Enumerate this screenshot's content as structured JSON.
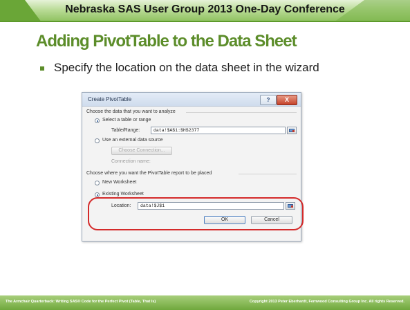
{
  "header": {
    "conference": "Nebraska SAS User Group 2013 One-Day Conference"
  },
  "slide": {
    "title": "Adding PivotTable to the Data Sheet",
    "bullet": "Specify the location on the data sheet in the wizard"
  },
  "dialog": {
    "title": "Create PivotTable",
    "help_label": "?",
    "close_label": "X",
    "section1_label": "Choose the data that you want to analyze",
    "option_select_range": "Select a table or range",
    "table_range_label": "Table/Range:",
    "table_range_value": "data!$A$1:$H$2377",
    "option_external": "Use an external data source",
    "choose_connection_label": "Choose Connection...",
    "connection_name_label": "Connection name:",
    "section2_label": "Choose where you want the PivotTable report to be placed",
    "option_new_worksheet": "New Worksheet",
    "option_existing_worksheet": "Existing Worksheet",
    "location_label": "Location:",
    "location_value": "data!$J$1",
    "ok_label": "OK",
    "cancel_label": "Cancel",
    "selected_data_option": "Select a table or range",
    "selected_placement_option": "Existing Worksheet"
  },
  "footer": {
    "left": "The Armchair Quarterback: Writing SAS® Code for the Perfect Pivot (Table, That Is)",
    "right": "Copyright 2013 Peter Eberhardt, Fernwood Consulting Group Inc. All rights Reserved."
  },
  "colors": {
    "accent_green": "#5c8d2a",
    "highlight_red": "#d42a2a"
  }
}
